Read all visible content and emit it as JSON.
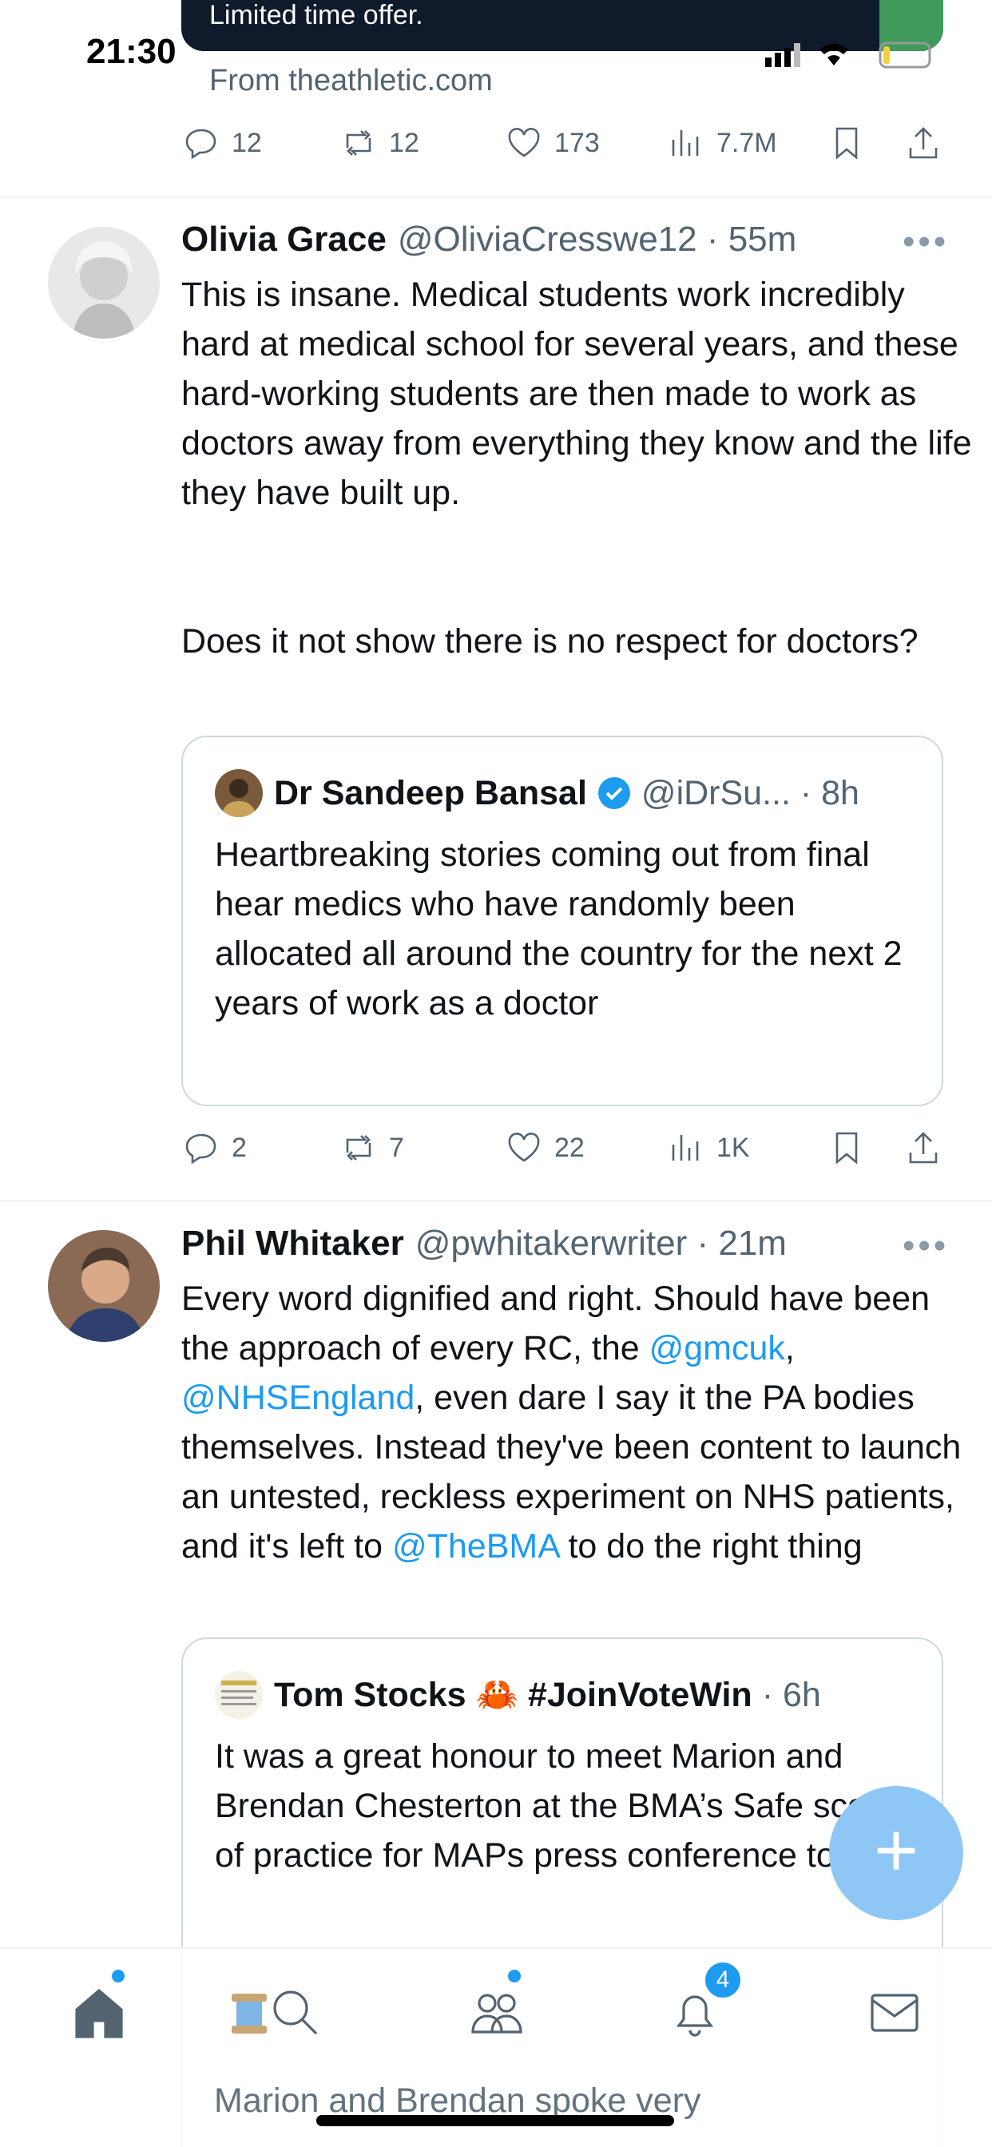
{
  "status_bar": {
    "time": "21:30"
  },
  "promo": {
    "text": "Limited time offer.",
    "from": "From theathletic.com"
  },
  "actions_top": {
    "replies": "12",
    "reposts": "12",
    "likes": "173",
    "views": "7.7M"
  },
  "tweets": [
    {
      "name": "Olivia Grace",
      "handle": "@OliviaCresswe12 · 55m",
      "text_p1": "This is insane. Medical students work incredibly hard at medical school for several years, and these hard-working students are then made to work as doctors away from everything they know and the life they have built up.",
      "text_p2": "Does it not show there is no respect for doctors?",
      "quote": {
        "name": "Dr Sandeep Bansal",
        "handle": "@iDrSu... · 8h",
        "text": "Heartbreaking stories coming out from final hear medics who have randomly been allocated all around the country for the next 2 years of work as a doctor"
      },
      "actions": {
        "replies": "2",
        "reposts": "7",
        "likes": "22",
        "views": "1K"
      }
    },
    {
      "name": "Phil Whitaker",
      "handle": "@pwhitakerwriter · 21m",
      "text_a": "Every word dignified and right. Should have been the approach of every RC, the ",
      "mention1": "@gmcuk",
      "text_b": ", ",
      "mention2": "@NHSEngland",
      "text_c": ", even dare I say it the PA bodies themselves. Instead they've been content to launch an untested, reckless experiment on NHS patients, and it's left to ",
      "mention3": "@TheBMA",
      "text_d": " to do the right thing",
      "quote": {
        "name": "Tom Stocks 🦀 #JoinVoteWin",
        "handle": "· 6h",
        "text": "It was a great honour to meet Marion and Brendan Chesterton at the BMA’s Safe scope of practice for MAPs press conference today.",
        "text_more": "Marion and Brendan spoke very"
      }
    }
  ],
  "nav": {
    "notifications_badge": "4"
  },
  "fab": {
    "label": "+"
  }
}
